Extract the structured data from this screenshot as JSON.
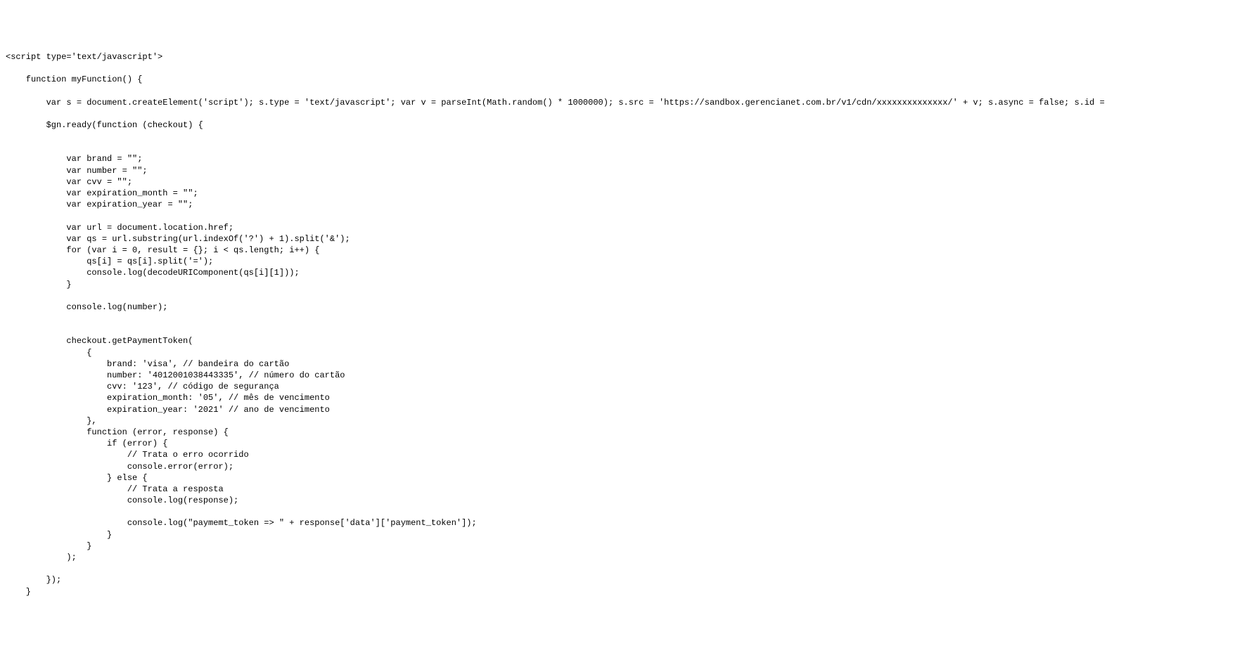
{
  "code": {
    "lines": [
      "<script type='text/javascript'>",
      "",
      "    function myFunction() {",
      "",
      "        var s = document.createElement('script'); s.type = 'text/javascript'; var v = parseInt(Math.random() * 1000000); s.src = 'https://sandbox.gerencianet.com.br/v1/cdn/xxxxxxxxxxxxxx/' + v; s.async = false; s.id =",
      "",
      "        $gn.ready(function (checkout) {",
      "",
      "",
      "            var brand = \"\";",
      "            var number = \"\";",
      "            var cvv = \"\";",
      "            var expiration_month = \"\";",
      "            var expiration_year = \"\";",
      "",
      "            var url = document.location.href;",
      "            var qs = url.substring(url.indexOf('?') + 1).split('&');",
      "            for (var i = 0, result = {}; i < qs.length; i++) {",
      "                qs[i] = qs[i].split('=');",
      "                console.log(decodeURIComponent(qs[i][1]));",
      "            }",
      "",
      "            console.log(number);",
      "",
      "",
      "            checkout.getPaymentToken(",
      "                {",
      "                    brand: 'visa', // bandeira do cartão",
      "                    number: '4012001038443335', // número do cartão",
      "                    cvv: '123', // código de segurança",
      "                    expiration_month: '05', // mês de vencimento",
      "                    expiration_year: '2021' // ano de vencimento",
      "                },",
      "                function (error, response) {",
      "                    if (error) {",
      "                        // Trata o erro ocorrido",
      "                        console.error(error);",
      "                    } else {",
      "                        // Trata a resposta",
      "                        console.log(response);",
      "",
      "                        console.log(\"paymemt_token => \" + response['data']['payment_token']);",
      "                    }",
      "                }",
      "            );",
      "",
      "        });",
      "    }"
    ]
  }
}
